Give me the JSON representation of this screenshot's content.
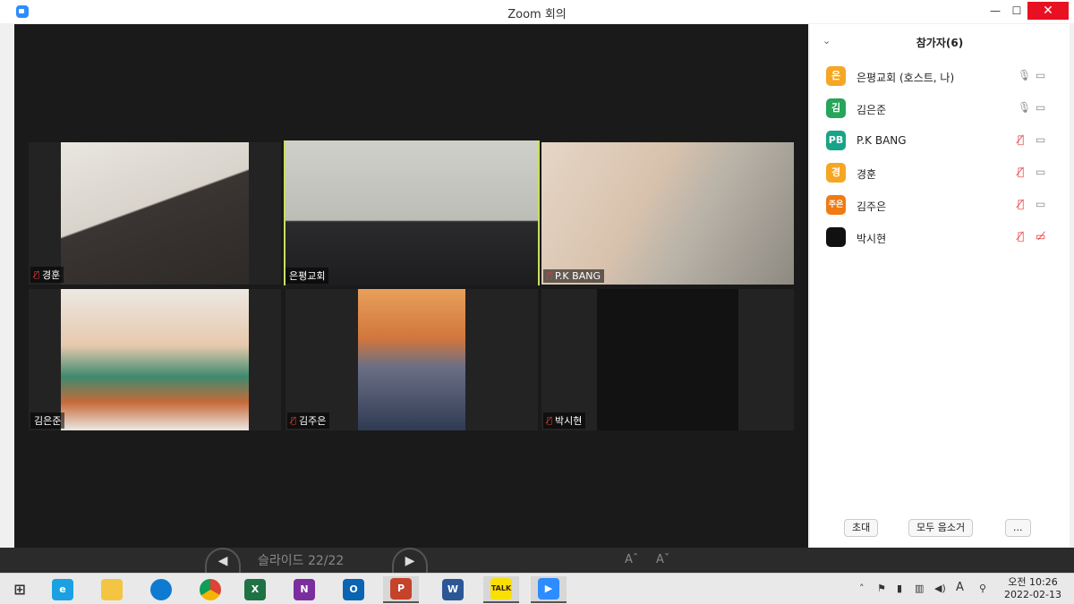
{
  "window": {
    "title": "Zoom 회의",
    "min_label": "—",
    "max_label": "☐",
    "close_label": "✕"
  },
  "tiles": [
    {
      "name": "경훈",
      "muted": true
    },
    {
      "name": "은평교회",
      "muted": false
    },
    {
      "name": "P.K BANG",
      "muted": true
    },
    {
      "name": "김은준",
      "muted": false
    },
    {
      "name": "김주은",
      "muted": true
    },
    {
      "name": "박시현",
      "muted": true
    }
  ],
  "participants": {
    "header": "참가자(6)",
    "items": [
      {
        "initial": "은",
        "name": "은평교회 (호스트, 나)",
        "color": "#f5a623"
      },
      {
        "initial": "김",
        "name": "김은준",
        "color": "#27a55a"
      },
      {
        "initial": "PB",
        "name": "P.K BANG",
        "color": "#19a489"
      },
      {
        "initial": "경",
        "name": "경훈",
        "color": "#f5a623"
      },
      {
        "initial": "주은",
        "name": "김주은",
        "color": "#f07b12"
      },
      {
        "initial": "",
        "name": "박시현",
        "color": "#111111"
      }
    ],
    "invite": "초대",
    "mute_all": "모두 음소거",
    "more": "..."
  },
  "slideshow": {
    "label": "슬라이드 22/22",
    "prev": "◀",
    "next": "▶"
  },
  "taskbar": {
    "clock_period": "오전 10:26",
    "clock_date": "2022-02-13",
    "ime": "A"
  },
  "accent": "#c8e05c"
}
